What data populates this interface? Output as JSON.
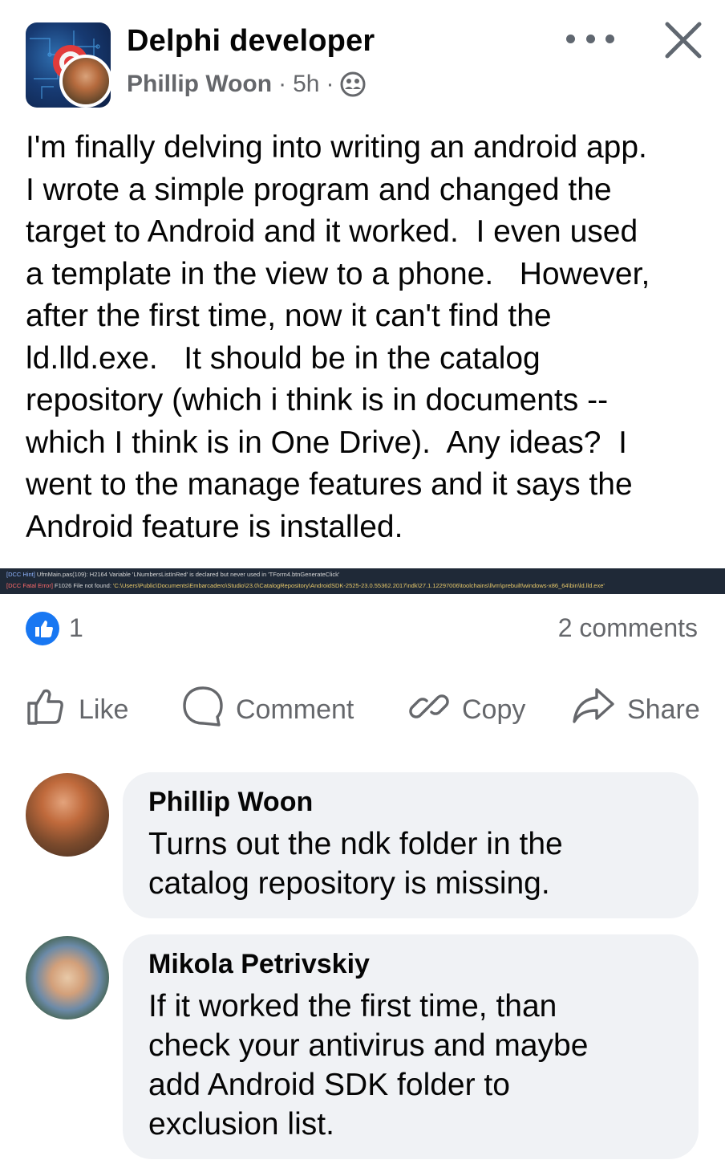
{
  "header": {
    "group_name": "Delphi developer",
    "author": "Phillip Woon",
    "sep1": "·",
    "time": "5h",
    "sep2": "·"
  },
  "post": {
    "text": "I'm finally delving into writing an android app.\nI wrote a simple program and changed the\ntarget to Android and it worked.  I even used\na template in the view to a phone.   However,\nafter the first time, now it can't find the\nld.lld.exe.   It should be in the catalog\nrepository (which i think is in documents --\nwhich I think is in One Drive).  Any ideas?  I\nwent to the manage features and it says the\nAndroid feature is installed."
  },
  "console": {
    "line1_tag": "[DCC Hint]",
    "line1_text": " UfmMain.pas(109): H2164 Variable 'LNumbersListInRed' is declared but never used in 'TForm4.btnGenerateClick'",
    "line2_tag": "[DCC Fatal Error]",
    "line2_text": " F1026 File not found: ",
    "line2_path": "'C:\\Users\\Public\\Documents\\Embarcadero\\Studio\\23.0\\CatalogRepository\\AndroidSDK-2525-23.0.55362.2017\\ndk\\27.1.12297006\\toolchains\\llvm\\prebuilt\\windows-x86_64\\bin\\ld.lld.exe'"
  },
  "reactions": {
    "like_count": "1",
    "comments": "2 comments"
  },
  "actions": {
    "like": "Like",
    "comment": "Comment",
    "copy": "Copy",
    "share": "Share"
  },
  "comments": [
    {
      "name": "Phillip Woon",
      "text": "Turns out the ndk folder in the\ncatalog repository is missing."
    },
    {
      "name": "Mikola Petrivskiy",
      "text": "If it worked the first time, than\ncheck your antivirus and maybe\nadd Android SDK folder to\nexclusion list."
    }
  ],
  "colors": {
    "accent": "#1877f2",
    "secondary_text": "#65676b",
    "bubble": "#f0f2f5"
  },
  "icons": [
    "more-icon",
    "close-icon",
    "audience-group-icon",
    "like-reaction-icon",
    "like-icon",
    "comment-icon",
    "copy-link-icon",
    "share-icon"
  ]
}
